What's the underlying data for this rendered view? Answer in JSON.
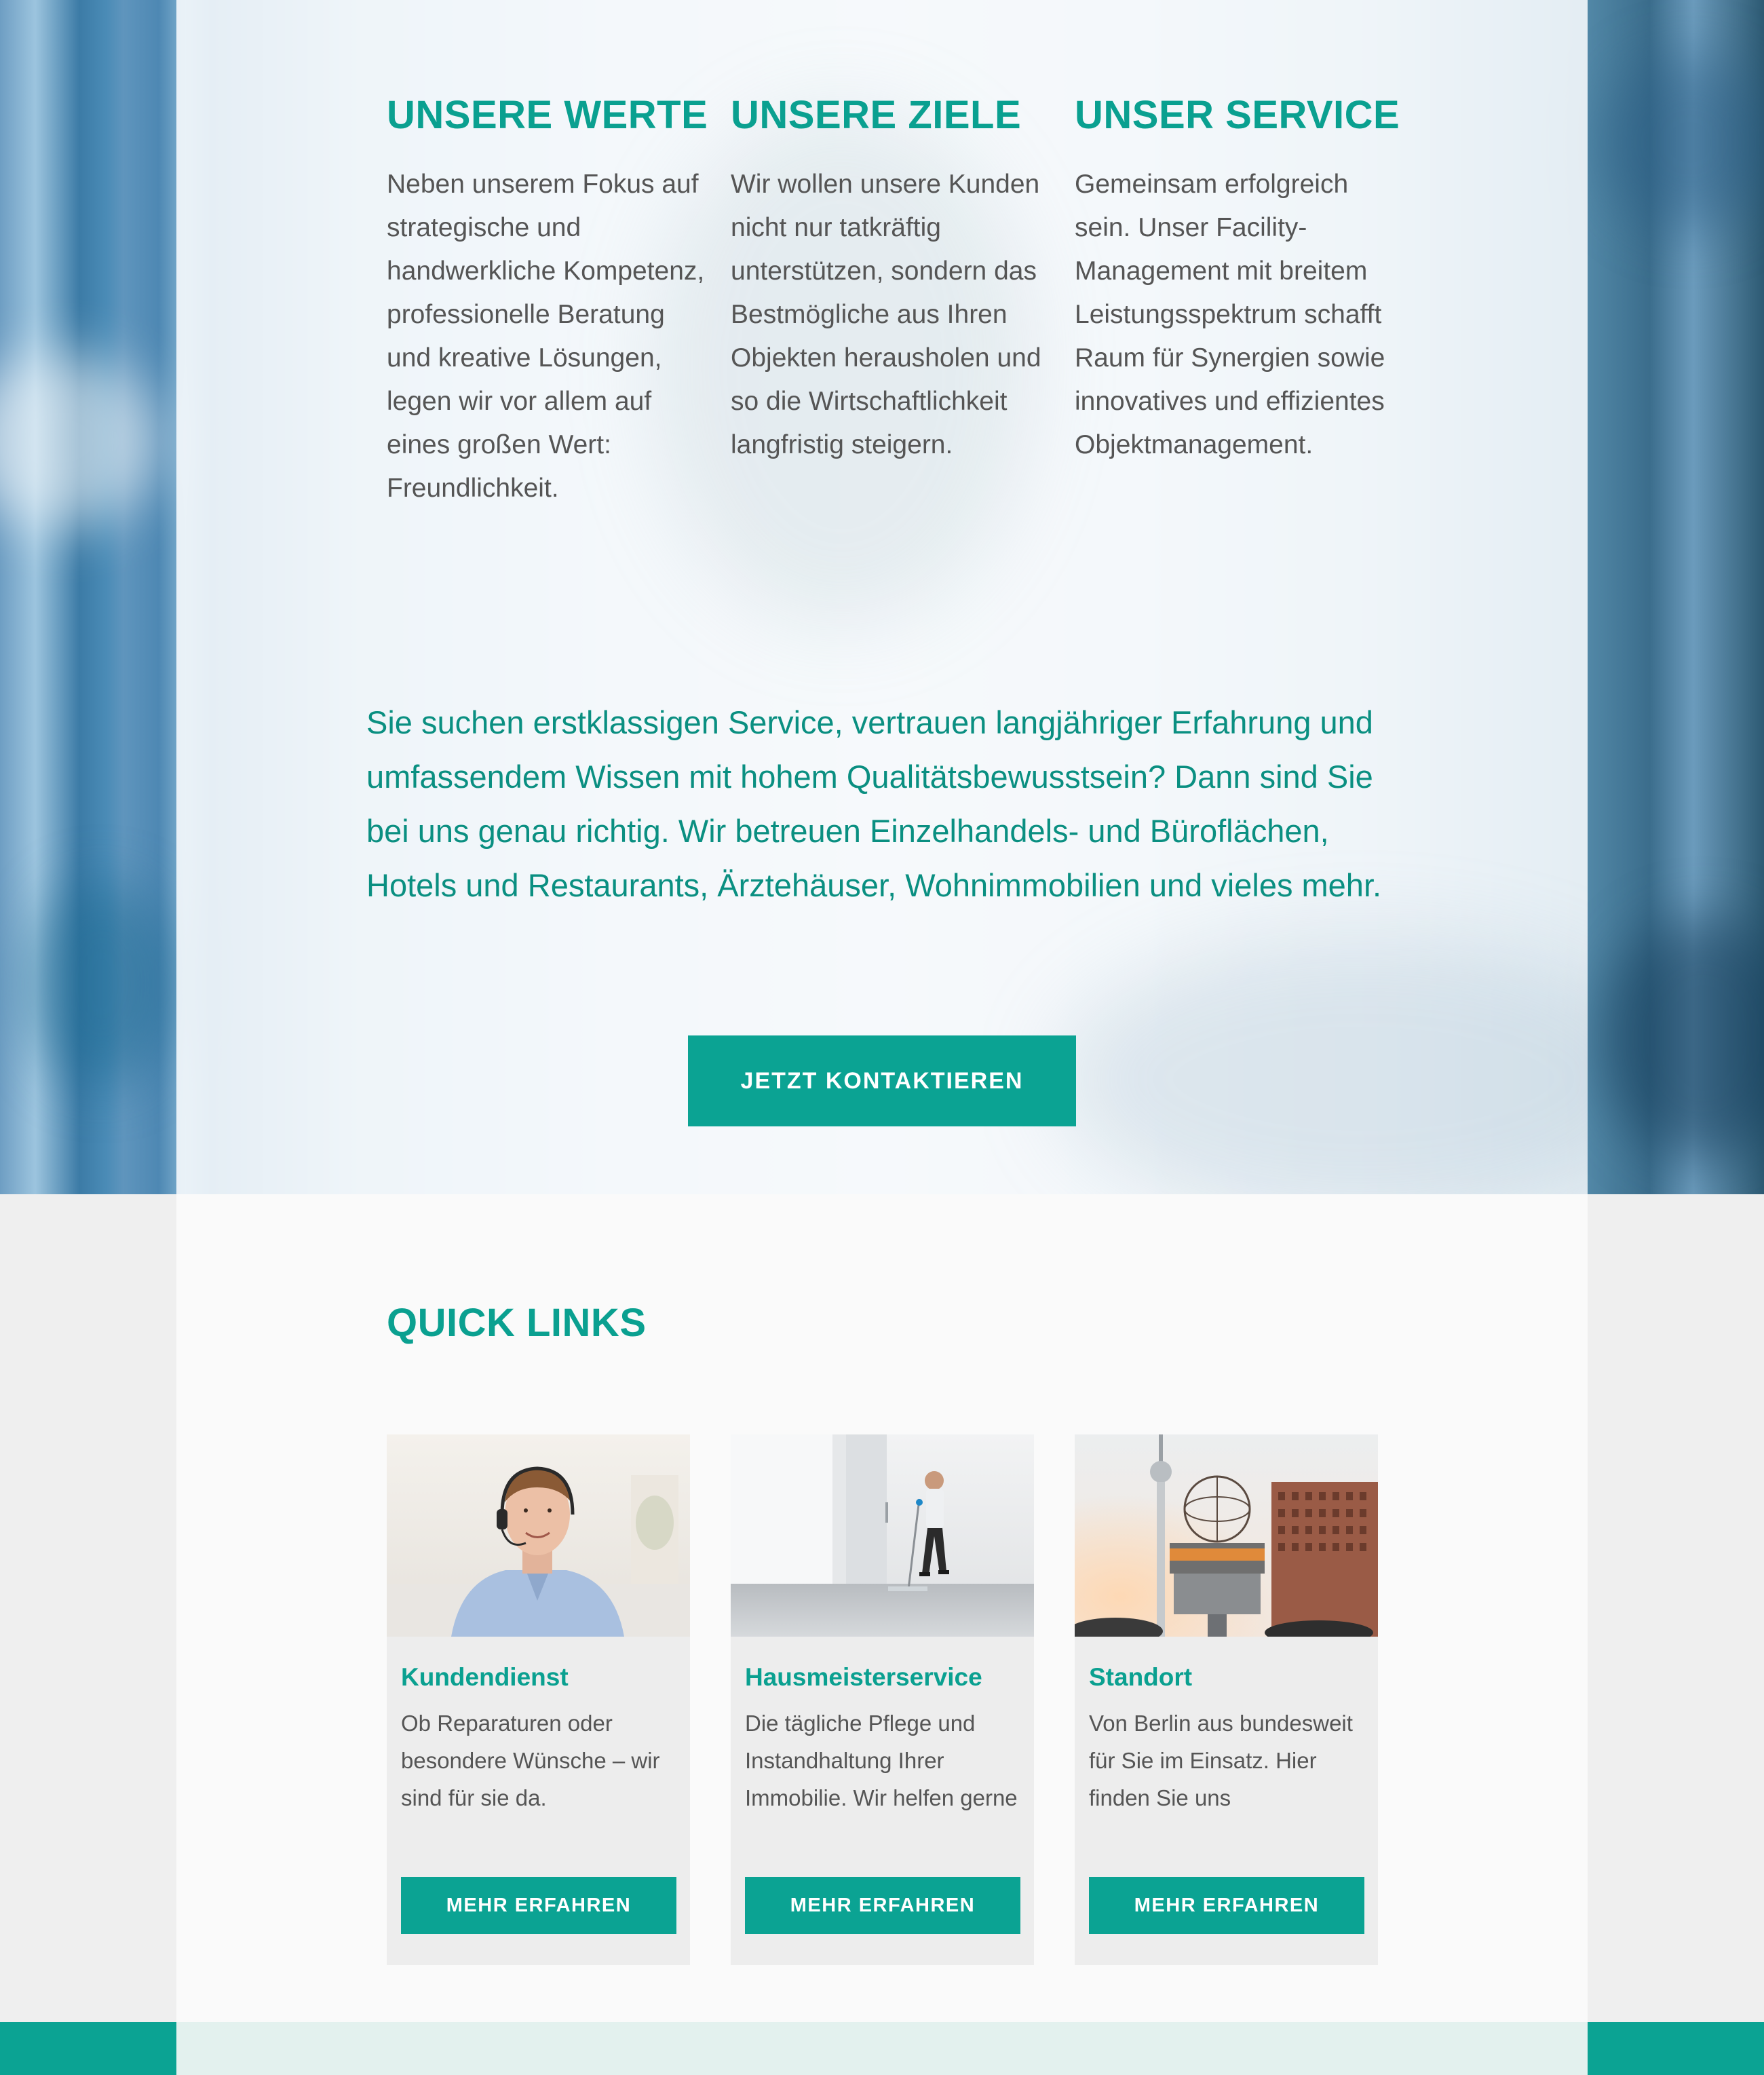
{
  "values": [
    {
      "title": "UNSERE WERTE",
      "text": "Neben unserem Fokus auf strategische und handwerkliche Kompetenz, professionelle Beratung und kreative Lösungen, legen wir vor allem auf eines großen Wert: Freundlichkeit."
    },
    {
      "title": "UNSERE ZIELE",
      "text": "Wir wollen unsere Kunden nicht nur tatkräftig unterstützen, sondern das Bestmögliche aus Ihren Objekten herausholen und so die Wirtschaftlichkeit langfristig steigern."
    },
    {
      "title": "UNSER SERVICE",
      "text": "Gemeinsam erfolgreich sein. Unser Facility-Management mit breitem Leistungsspektrum schafft Raum für Synergien sowie innovatives und effizientes Objektmanagement."
    }
  ],
  "lead_text": "Sie suchen erstklassigen Service, vertrauen langjähriger Erfahrung und umfassendem Wissen mit hohem Qualitätsbewusstsein? Dann sind Sie bei uns genau richtig. Wir betreuen Einzelhandels- und Büroflächen, Hotels und Restaurants, Ärztehäuser, Wohnimmobilien und vieles mehr.",
  "cta_label": "JETZT KONTAKTIEREN",
  "quick_links": {
    "title": "QUICK LINKS",
    "cards": [
      {
        "title": "Kundendienst",
        "text": "Ob Reparaturen oder besondere Wünsche – wir sind für sie da.",
        "button": "MEHR ERFAHREN",
        "image": "support-agent-with-headset"
      },
      {
        "title": "Hausmeisterservice",
        "text": "Die tägliche Pflege und Instandhaltung Ihrer Immobilie. Wir helfen gerne",
        "button": "MEHR ERFAHREN",
        "image": "janitor-mopping-floor"
      },
      {
        "title": "Standort",
        "text": "Von Berlin aus bundesweit für Sie im Einsatz. Hier finden Sie uns",
        "button": "MEHR ERFAHREN",
        "image": "berlin-world-clock-tv-tower"
      }
    ]
  },
  "colors": {
    "accent": "#0ba393",
    "heading": "#0aa090",
    "lead_text": "#0a8f81",
    "body_text": "#555555",
    "card_bg": "#ededed",
    "section_bg": "#fafafa"
  }
}
